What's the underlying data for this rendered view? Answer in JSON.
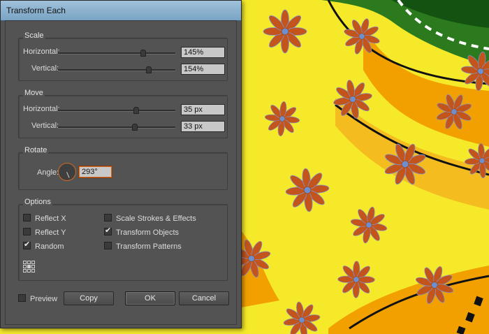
{
  "dialog": {
    "title": "Transform Each",
    "scale": {
      "legend": "Scale",
      "horizontal": {
        "label": "Horizontal:",
        "value": "145%",
        "level": 0.72
      },
      "vertical": {
        "label": "Vertical:",
        "value": "154%",
        "level": 0.77
      }
    },
    "move": {
      "legend": "Move",
      "horizontal": {
        "label": "Horizontal:",
        "value": "35 px",
        "level": 0.66
      },
      "vertical": {
        "label": "Vertical:",
        "value": "33 px",
        "level": 0.65
      }
    },
    "rotate": {
      "legend": "Rotate",
      "angle_label": "Angle:",
      "angle_value": "293°",
      "angle_degrees": 293
    },
    "options": {
      "legend": "Options",
      "reflect_x": {
        "label": "Reflect X",
        "checked": false
      },
      "reflect_y": {
        "label": "Reflect Y",
        "checked": false
      },
      "random": {
        "label": "Random",
        "checked": true
      },
      "scale_strokes": {
        "label": "Scale Strokes & Effects",
        "checked": false
      },
      "transform_objects": {
        "label": "Transform Objects",
        "checked": true
      },
      "transform_patterns": {
        "label": "Transform Patterns",
        "checked": false
      }
    },
    "preview": {
      "label": "Preview",
      "checked": false
    },
    "buttons": {
      "copy": "Copy",
      "ok": "OK",
      "cancel": "Cancel"
    }
  },
  "colors": {
    "canvas_yellow": "#f5e92a",
    "petal": "#c2541c",
    "flower_center": "#6b8fd0",
    "orange_band": "#f1a000",
    "green_shape": "#2c7a1e",
    "dialog_bg": "#535353",
    "focus_orange": "#d26a25"
  }
}
